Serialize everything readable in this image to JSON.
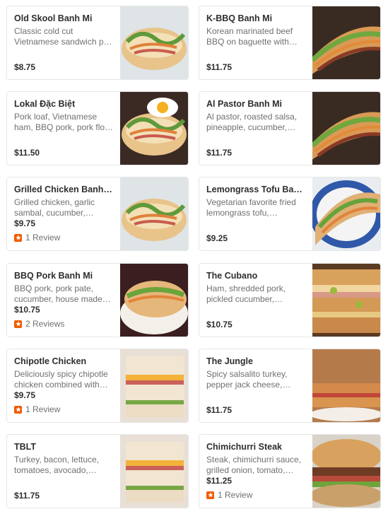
{
  "menu": {
    "items": [
      {
        "name": "Old Skool Banh Mi",
        "desc": "Classic cold cut Vietnamese sandwich p…",
        "price": "$8.75",
        "reviews": "",
        "photo": "baguette-open"
      },
      {
        "name": "K-BBQ Banh Mi",
        "desc": "Korean marinated beef BBQ on baguette with…",
        "price": "$11.75",
        "reviews": "",
        "photo": "baguette-long"
      },
      {
        "name": "Lokal Đặc Biệt",
        "desc": "Pork loaf, Vietnamese ham, BBQ pork, pork flo…",
        "price": "$11.50",
        "reviews": "",
        "photo": "baguette-egg"
      },
      {
        "name": "Al Pastor Banh Mi",
        "desc": "Al pastor, roasted salsa, pineapple, cucumber,…",
        "price": "$11.75",
        "reviews": "",
        "photo": "baguette-long"
      },
      {
        "name": "Grilled Chicken Banh Mi",
        "desc": "Grilled chicken, garlic sambal, cucumber, hous…",
        "price": "$9.75",
        "reviews": "1 Review",
        "photo": "baguette-open"
      },
      {
        "name": "Lemongrass Tofu Ban…",
        "desc": "Vegetarian favorite fried lemongrass tofu,…",
        "price": "$9.25",
        "reviews": "",
        "photo": "baguette-blue-plate"
      },
      {
        "name": "BBQ Pork Banh Mi",
        "desc": "BBQ pork, pork pate, cucumber, house made…",
        "price": "$10.75",
        "reviews": "2 Reviews",
        "photo": "baguette-plate"
      },
      {
        "name": "The Cubano",
        "desc": "Ham, shredded pork, pickled cucumber, Swiss…",
        "price": "$10.75",
        "reviews": "",
        "photo": "pressed-sandwich"
      },
      {
        "name": "Chipotle Chicken",
        "desc": "Deliciously spicy chipotle chicken combined with…",
        "price": "$9.75",
        "reviews": "1 Review",
        "photo": "stacked-sandwich"
      },
      {
        "name": "The Jungle",
        "desc": "Spicy salsalito turkey, pepper jack cheese,…",
        "price": "$11.75",
        "reviews": "",
        "photo": "panini"
      },
      {
        "name": "TBLT",
        "desc": "Turkey, bacon, lettuce, tomatoes, avocado,…",
        "price": "$11.75",
        "reviews": "",
        "photo": "stacked-sandwich"
      },
      {
        "name": "Chimichurri Steak",
        "desc": "Steak, chimichurri sauce, grilled onion, tomato,…",
        "price": "$11.25",
        "reviews": "1 Review",
        "photo": "steak-sandwich"
      }
    ]
  },
  "colors": {
    "review_badge": "#f15c00",
    "name_text": "#2d2e2e",
    "desc_text": "#6e7072",
    "card_border": "#e6e6e6"
  }
}
